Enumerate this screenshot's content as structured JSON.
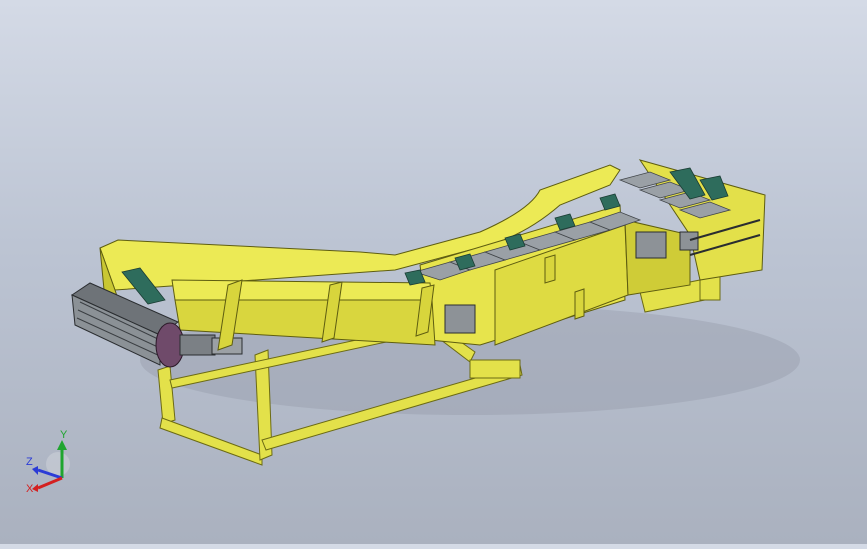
{
  "viewport": {
    "background_top": "#d4dae6",
    "background_bottom": "#aab1bf"
  },
  "model": {
    "frame_color": "#e9e64a",
    "frame_shadow": "#b9b61e",
    "belt_color": "#2f6b5b",
    "roller_color": "#8a8f93",
    "motor_color": "#6f4a6a"
  },
  "triad": {
    "axis_y_label": "Y",
    "axis_z_label": "Z",
    "axis_x_label": "X",
    "axis_y_color": "#1fa52f",
    "axis_z_color": "#2b3bd6",
    "axis_x_color": "#d42020"
  }
}
